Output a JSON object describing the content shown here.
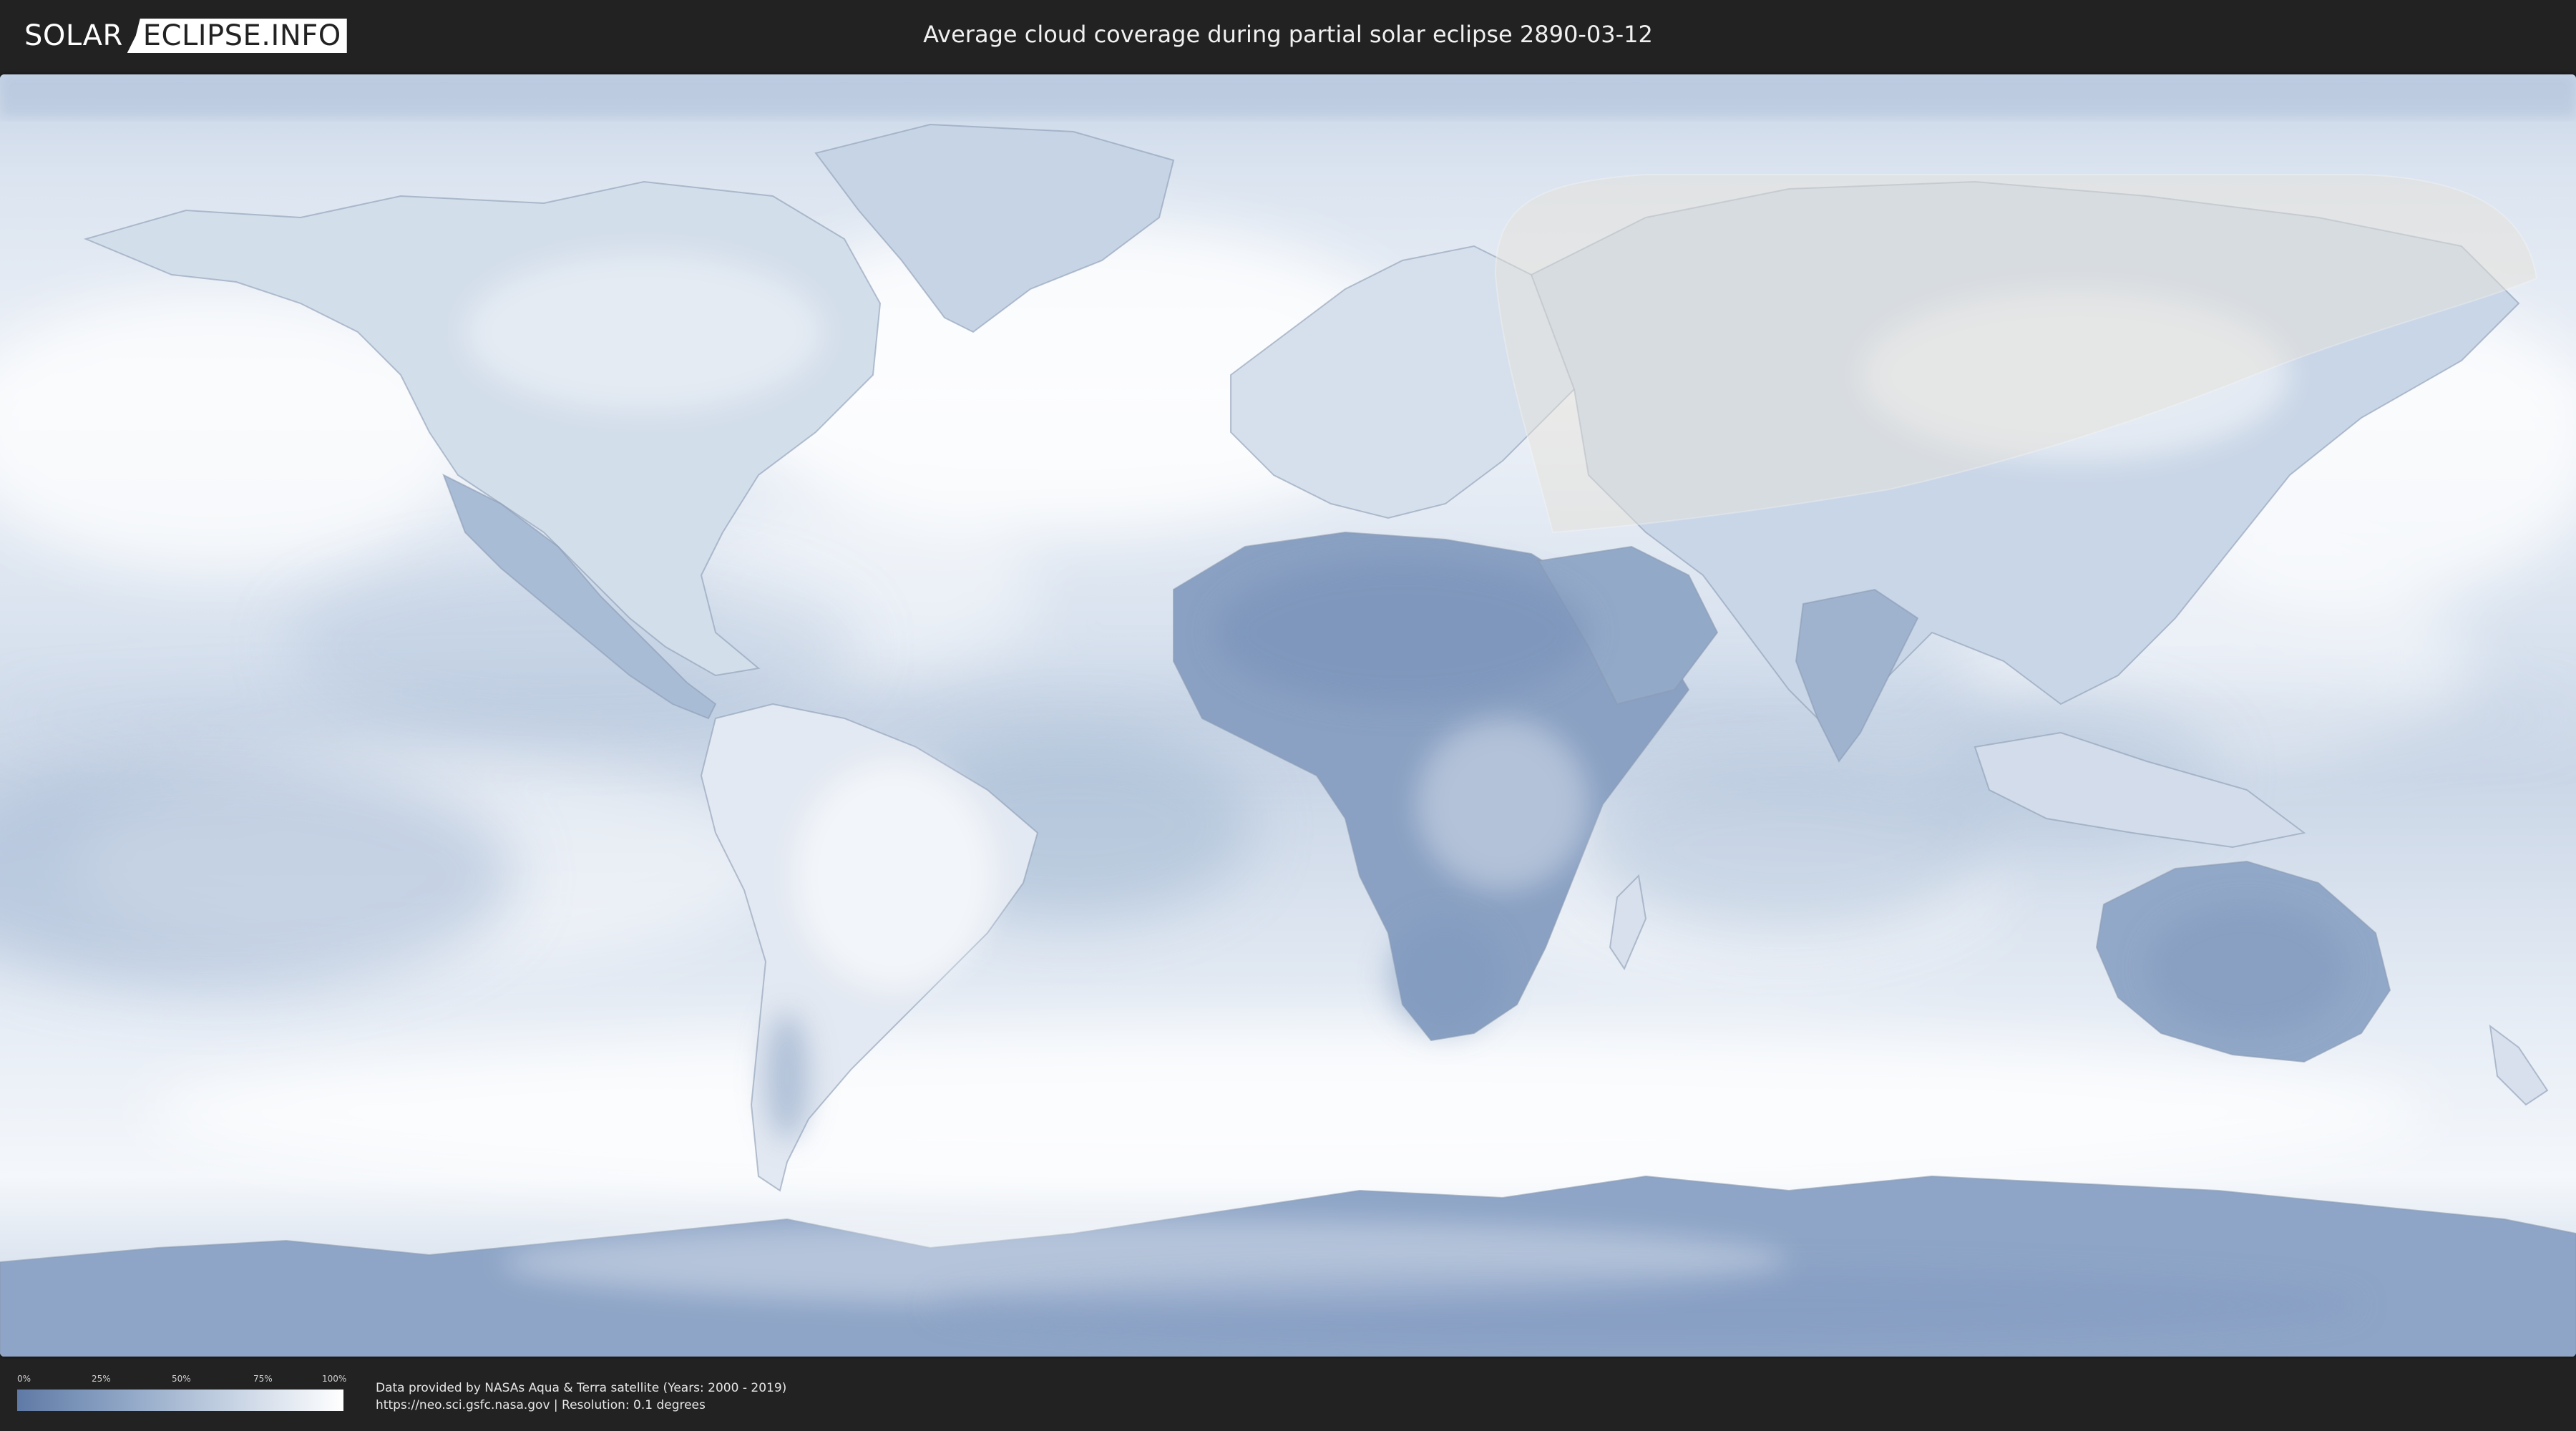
{
  "header": {
    "logo_left": "SOLAR",
    "logo_right": "ECLIPSE.INFO",
    "title": "Average cloud coverage during partial solar eclipse 2890-03-12"
  },
  "legend": {
    "ticks": [
      "0%",
      "25%",
      "50%",
      "75%",
      "100%"
    ],
    "gradient_colors": [
      "#5f7aa6",
      "#8fa6c6",
      "#c8d4e4",
      "#ffffff"
    ]
  },
  "credits": {
    "line1": "Data provided by NASAs Aqua & Terra satellite (Years: 2000 - 2019)",
    "line2": "https://neo.sci.gsfc.nasa.gov | Resolution: 0.1 degrees"
  },
  "map": {
    "projection": "equirectangular",
    "eclipse_zone": "partial eclipse visibility region over northern Europe and Asia",
    "colors": {
      "clear_sky": "#5f7aa6",
      "cloudy": "#ffffff",
      "eclipse_overlay": "#e6e2da"
    }
  }
}
